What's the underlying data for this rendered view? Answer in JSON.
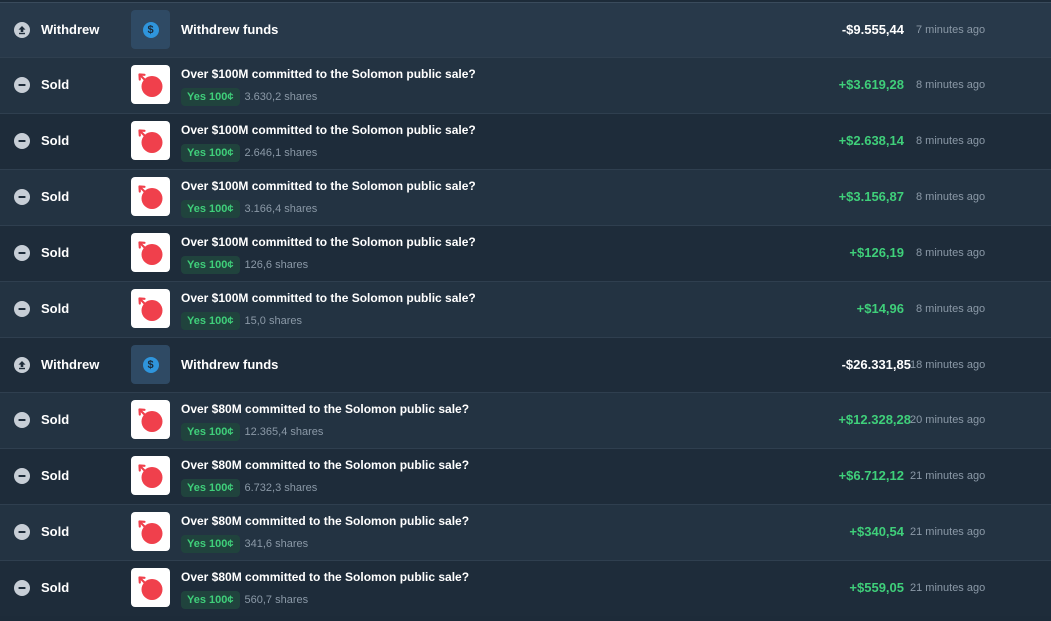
{
  "activity": [
    {
      "kind": "withdraw",
      "type_label": "Withdrew",
      "title": "Withdrew funds",
      "amount": "-$9.555,44",
      "time": "7 minutes ago",
      "icon": "withdraw-icon"
    },
    {
      "kind": "sold",
      "type_label": "Sold",
      "title": "Over $100M committed to the Solomon public sale?",
      "chip": "Yes 100¢",
      "shares": "3.630,2 shares",
      "amount": "+$3.619,28",
      "time": "8 minutes ago",
      "icon": "sold-icon"
    },
    {
      "kind": "sold",
      "type_label": "Sold",
      "title": "Over $100M committed to the Solomon public sale?",
      "chip": "Yes 100¢",
      "shares": "2.646,1 shares",
      "amount": "+$2.638,14",
      "time": "8 minutes ago",
      "icon": "sold-icon"
    },
    {
      "kind": "sold",
      "type_label": "Sold",
      "title": "Over $100M committed to the Solomon public sale?",
      "chip": "Yes 100¢",
      "shares": "3.166,4 shares",
      "amount": "+$3.156,87",
      "time": "8 minutes ago",
      "icon": "sold-icon"
    },
    {
      "kind": "sold",
      "type_label": "Sold",
      "title": "Over $100M committed to the Solomon public sale?",
      "chip": "Yes 100¢",
      "shares": "126,6 shares",
      "amount": "+$126,19",
      "time": "8 minutes ago",
      "icon": "sold-icon"
    },
    {
      "kind": "sold",
      "type_label": "Sold",
      "title": "Over $100M committed to the Solomon public sale?",
      "chip": "Yes 100¢",
      "shares": "15,0 shares",
      "amount": "+$14,96",
      "time": "8 minutes ago",
      "icon": "sold-icon"
    },
    {
      "kind": "withdraw",
      "type_label": "Withdrew",
      "title": "Withdrew funds",
      "amount": "-$26.331,85",
      "time": "18 minutes ago",
      "icon": "withdraw-icon"
    },
    {
      "kind": "sold",
      "type_label": "Sold",
      "title": "Over $80M committed to the Solomon public sale?",
      "chip": "Yes 100¢",
      "shares": "12.365,4 shares",
      "amount": "+$12.328,28",
      "time": "20 minutes ago",
      "icon": "sold-icon"
    },
    {
      "kind": "sold",
      "type_label": "Sold",
      "title": "Over $80M committed to the Solomon public sale?",
      "chip": "Yes 100¢",
      "shares": "6.732,3 shares",
      "amount": "+$6.712,12",
      "time": "21 minutes ago",
      "icon": "sold-icon"
    },
    {
      "kind": "sold",
      "type_label": "Sold",
      "title": "Over $80M committed to the Solomon public sale?",
      "chip": "Yes 100¢",
      "shares": "341,6 shares",
      "amount": "+$340,54",
      "time": "21 minutes ago",
      "icon": "sold-icon"
    },
    {
      "kind": "sold",
      "type_label": "Sold",
      "title": "Over $80M committed to the Solomon public sale?",
      "chip": "Yes 100¢",
      "shares": "560,7 shares",
      "amount": "+$559,05",
      "time": "21 minutes ago",
      "icon": "sold-icon"
    }
  ],
  "colors": {
    "positive": "#3fcf7a",
    "negative": "#ffffff",
    "market_logo": "#f0404c",
    "withdraw_coin": "#2f95dc"
  }
}
